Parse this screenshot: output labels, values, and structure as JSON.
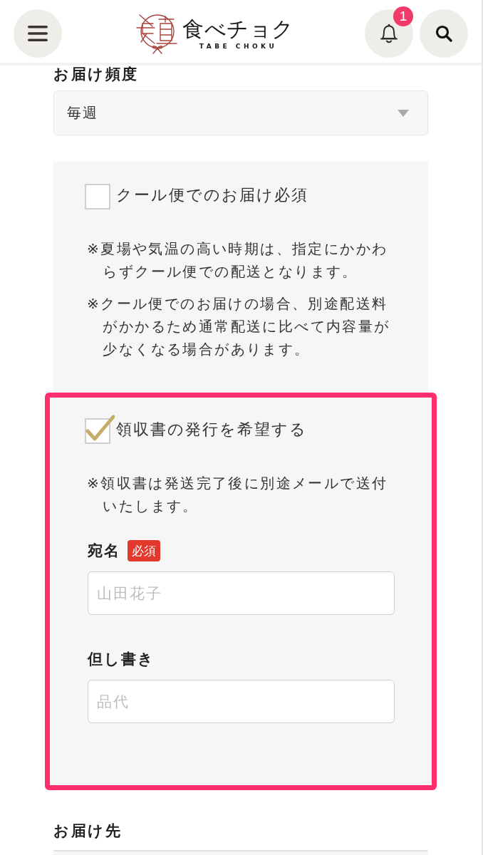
{
  "header": {
    "logo": {
      "name": "食べチョク",
      "subtitle": "TABE CHOKU"
    },
    "notification_badge": "1"
  },
  "frequency": {
    "label": "お届け頻度",
    "value": "毎週"
  },
  "options": [
    {
      "kind": "checkbox",
      "label": "クール便でのお届け必須",
      "checked": false,
      "highlighted": false,
      "notes": [
        "※夏場や気温の高い時期は、指定にかかわらずクール便での配送となります。",
        "※クール便でのお届けの場合、別途配送料がかかるため通常配送に比べて内容量が少なくなる場合があります。"
      ]
    },
    {
      "kind": "checkbox",
      "label": "領収書の発行を希望する",
      "checked": true,
      "highlighted": true,
      "notes": [
        "※領収書は発送完了後に別途メールで送付いたします。"
      ],
      "fields": [
        {
          "label": "宛名",
          "required_badge": "必須",
          "placeholder": "山田花子"
        },
        {
          "label": "但し書き",
          "placeholder": "品代"
        }
      ]
    }
  ],
  "delivery": {
    "label": "お届け先"
  }
}
